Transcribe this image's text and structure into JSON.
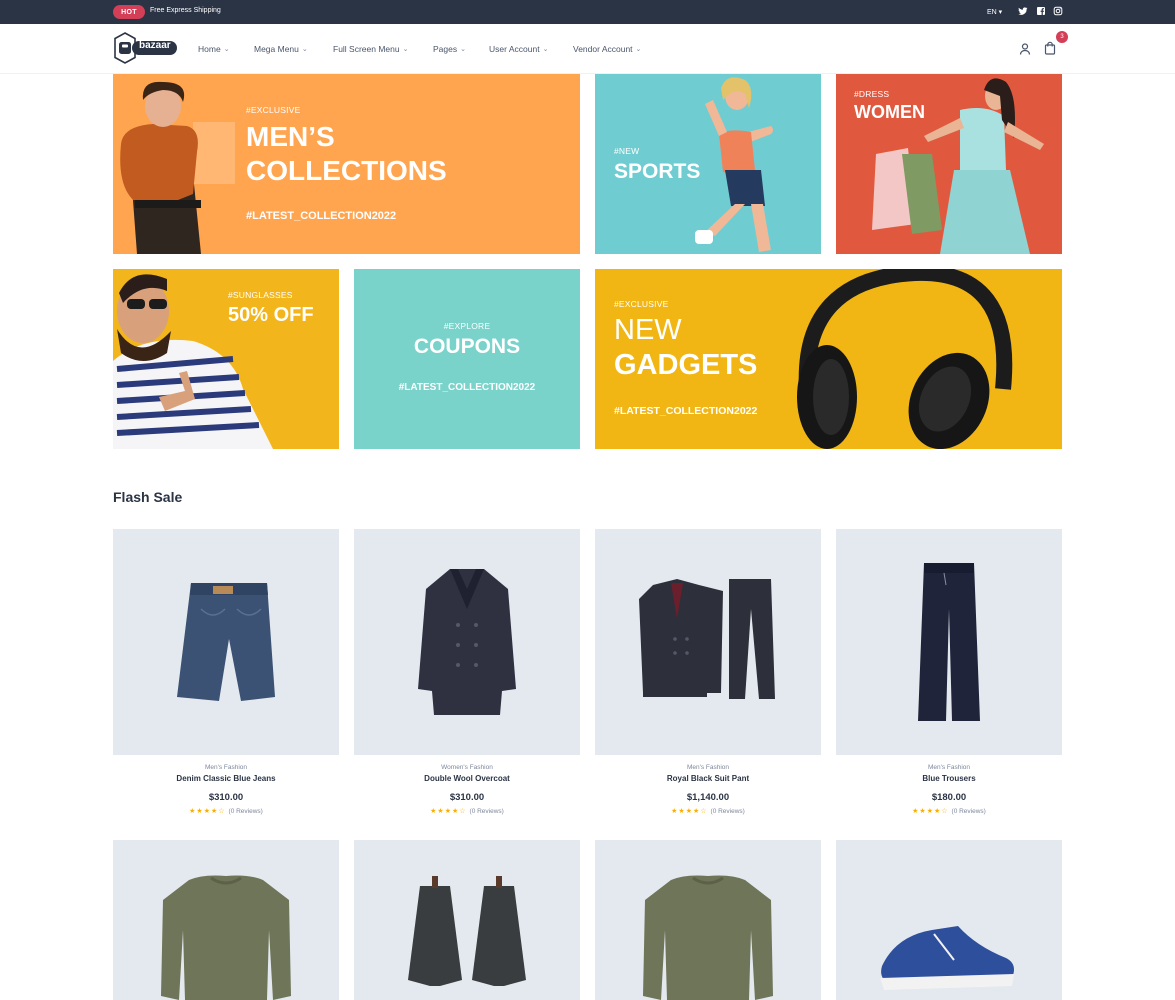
{
  "topbar": {
    "hot_label": "HOT",
    "shipping_text": "Free Express Shipping",
    "language": "EN",
    "social": [
      "twitter-icon",
      "facebook-icon",
      "instagram-icon"
    ]
  },
  "header": {
    "logo_text": "bazaar",
    "nav": [
      "Home",
      "Mega Menu",
      "Full Screen Menu",
      "Pages",
      "User Account",
      "Vendor Account"
    ],
    "cart_count": "3"
  },
  "banners": {
    "mens": {
      "tag": "#EXCLUSIVE",
      "title_line1": "MEN’S",
      "title_line2": "COLLECTIONS",
      "subtitle": "#LATEST_COLLECTION2022",
      "bg": "#ffa550"
    },
    "sports": {
      "tag": "#NEW",
      "title": "SPORTS",
      "bg": "#6fcdd2"
    },
    "women": {
      "tag": "#DRESS",
      "title": "WOMEN",
      "bg": "#e0593f"
    },
    "sunglasses": {
      "tag": "#SUNGLASSES",
      "title": "50% OFF",
      "bg": "#f3b51c"
    },
    "coupons": {
      "tag": "#EXPLORE",
      "title": "COUPONS",
      "subtitle": "#LATEST_COLLECTION2022",
      "bg": "#79d3cb"
    },
    "gadgets": {
      "tag": "#EXCLUSIVE",
      "title_line1": "NEW",
      "title_line2": "GADGETS",
      "subtitle": "#LATEST_COLLECTION2022",
      "bg": "#f1b614"
    }
  },
  "flash_sale": {
    "title": "Flash Sale",
    "products": [
      {
        "category": "Men's Fashion",
        "name": "Denim Classic Blue Jeans",
        "price": "$310.00",
        "stars": "★★★★☆",
        "reviews": "(0 Reviews)",
        "rating": 4
      },
      {
        "category": "Women's Fashion",
        "name": "Double Wool Overcoat",
        "price": "$310.00",
        "stars": "★★★★☆",
        "reviews": "(0 Reviews)",
        "rating": 4
      },
      {
        "category": "Men's Fashion",
        "name": "Royal Black Suit Pant",
        "price": "$1,140.00",
        "stars": "★★★★☆",
        "reviews": "(0 Reviews)",
        "rating": 4
      },
      {
        "category": "Men's Fashion",
        "name": "Blue Trousers",
        "price": "$180.00",
        "stars": "★★★★☆",
        "reviews": "(0 Reviews)",
        "rating": 4
      }
    ]
  },
  "colors": {
    "primary": "#d23f57",
    "dark": "#2b3445",
    "card_bg": "#e3e9ef",
    "star": "#faaf00"
  }
}
